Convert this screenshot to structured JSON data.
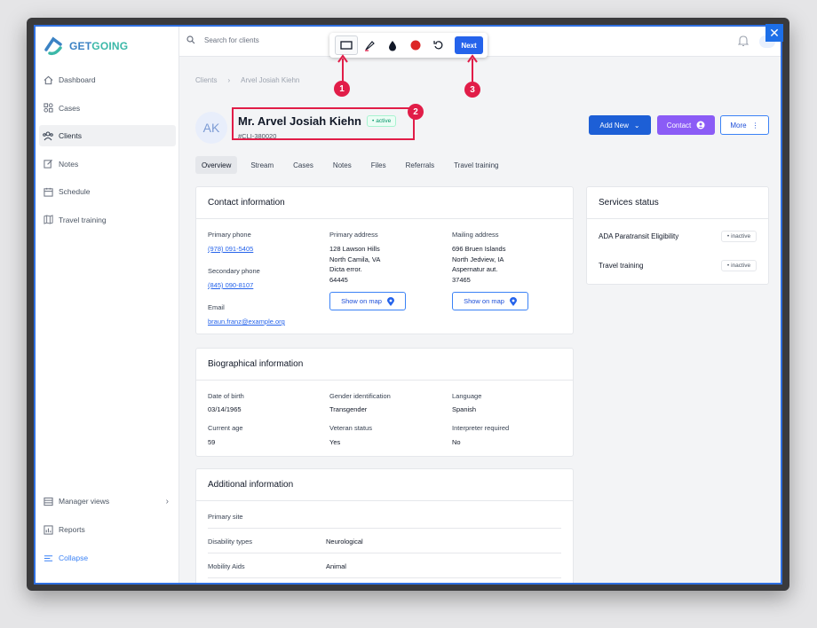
{
  "app": {
    "logo_get": "GET",
    "logo_going": "GOING",
    "close_label": "✕"
  },
  "search": {
    "placeholder": "Search for clients"
  },
  "toolbar": {
    "next_label": "Next"
  },
  "sidebar": {
    "items": [
      {
        "label": "Dashboard",
        "icon": "home-icon"
      },
      {
        "label": "Cases",
        "icon": "cases-icon"
      },
      {
        "label": "Clients",
        "icon": "users-icon",
        "active": true
      },
      {
        "label": "Notes",
        "icon": "edit-icon"
      },
      {
        "label": "Schedule",
        "icon": "calendar-icon"
      },
      {
        "label": "Travel training",
        "icon": "map-icon"
      }
    ],
    "bottom": [
      {
        "label": "Manager views",
        "icon": "table-icon"
      },
      {
        "label": "Reports",
        "icon": "chart-icon"
      },
      {
        "label": "Collapse",
        "icon": "menu-icon"
      }
    ]
  },
  "breadcrumb": {
    "root": "Clients",
    "current": "Arvel Josiah Kiehn"
  },
  "client": {
    "initials": "AK",
    "name": "Mr. Arvel Josiah Kiehn",
    "status": "active",
    "id": "#CLI-380020"
  },
  "actions": {
    "add_new": "Add New",
    "contact": "Contact",
    "more": "More"
  },
  "tabs": [
    "Overview",
    "Stream",
    "Cases",
    "Notes",
    "Files",
    "Referrals",
    "Travel training"
  ],
  "contact": {
    "title": "Contact information",
    "primary_phone_label": "Primary phone",
    "primary_phone": "(978) 091-5405",
    "secondary_phone_label": "Secondary phone",
    "secondary_phone": "(845) 090-8107",
    "email_label": "Email",
    "email": "braun.franz@example.org",
    "primary_address_label": "Primary address",
    "primary_address": [
      "128 Lawson Hills",
      "North Camila, VA",
      "Dicta error.",
      "64445"
    ],
    "mailing_address_label": "Mailing address",
    "mailing_address": [
      "696 Bruen Islands",
      "North Jedview, IA",
      "Aspernatur aut.",
      "37465"
    ],
    "show_on_map": "Show on map"
  },
  "services": {
    "title": "Services status",
    "items": [
      {
        "label": "ADA Paratransit Eligibility",
        "status": "inactive"
      },
      {
        "label": "Travel training",
        "status": "inactive"
      }
    ]
  },
  "bio": {
    "title": "Biographical information",
    "dob_label": "Date of birth",
    "dob": "03/14/1965",
    "gender_label": "Gender identification",
    "gender": "Transgender",
    "language_label": "Language",
    "language": "Spanish",
    "age_label": "Current age",
    "age": "59",
    "veteran_label": "Veteran status",
    "veteran": "Yes",
    "interpreter_label": "Interpreter required",
    "interpreter": "No"
  },
  "additional": {
    "title": "Additional information",
    "rows": [
      {
        "label": "Primary site",
        "value": ""
      },
      {
        "label": "Disability types",
        "value": "Neurological"
      },
      {
        "label": "Mobility Aids",
        "value": "Animal"
      }
    ]
  },
  "callouts": [
    "1",
    "2",
    "3"
  ],
  "colors": {
    "accent": "#2563eb",
    "annotation": "#e11d48",
    "contact": "#8b5cf6"
  }
}
